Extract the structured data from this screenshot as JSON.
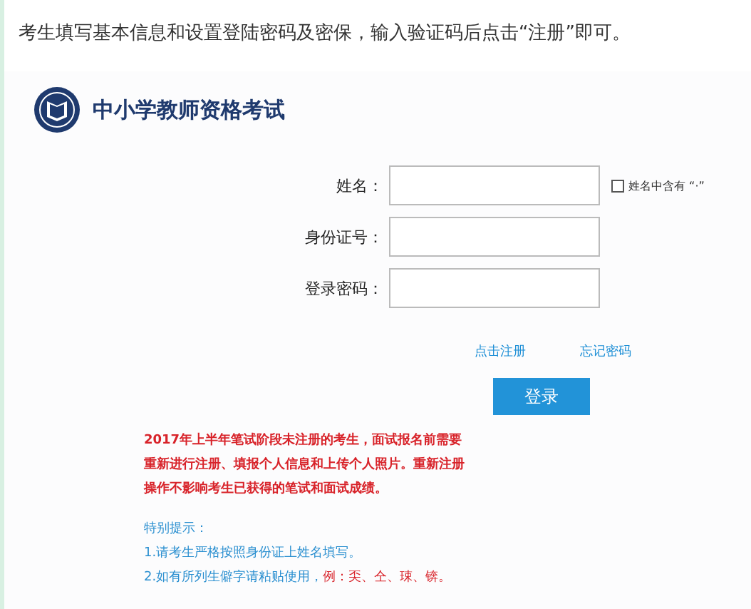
{
  "intro": "考生填写基本信息和设置登陆密码及密保，输入验证码后点击“注册”即可。",
  "site": {
    "title": "中小学教师资格考试"
  },
  "fields": [
    {
      "label": "姓名：",
      "kind": "name"
    },
    {
      "label": "身份证号：",
      "kind": "text"
    },
    {
      "label": "登录密码：",
      "kind": "password"
    }
  ],
  "name_option": {
    "label": "姓名中含有 “·”",
    "checked": false
  },
  "links": [
    "点击注册",
    "忘记密码"
  ],
  "login_button": "登录",
  "notice": "2017年上半年笔试阶段未注册的考生，面试报名前需要重新进行注册、填报个人信息和上传个人照片。重新注册操作不影响考生已获得的笔试和面试成绩。",
  "tips": {
    "title": "特别提示：",
    "items": [
      {
        "text": "1.请考生严格按照身份证上姓名填写。"
      },
      {
        "text": "2.如有所列生僻字请粘贴使用，",
        "example": "例：奀、仝、㻋、锛。"
      }
    ]
  }
}
